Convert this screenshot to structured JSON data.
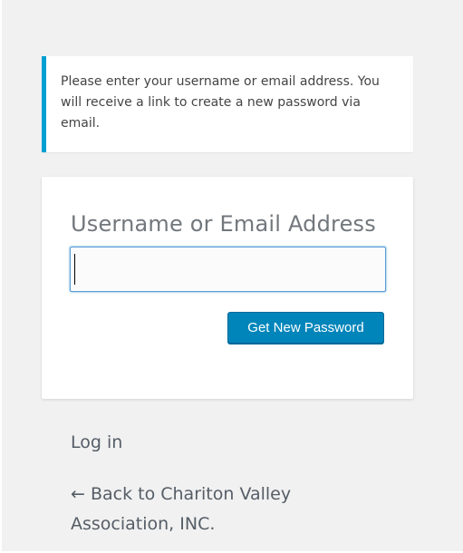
{
  "message": {
    "text": "Please enter your username or email address. You will receive a link to create a new password via email."
  },
  "form": {
    "field_label": "Username or Email Address",
    "field_value": "",
    "submit_label": "Get New Password"
  },
  "links": {
    "login": "Log in",
    "back": "← Back to Chariton Valley Association, INC."
  },
  "colors": {
    "accent": "#00a0d2",
    "button": "#0085ba",
    "background": "#f1f1f1"
  }
}
